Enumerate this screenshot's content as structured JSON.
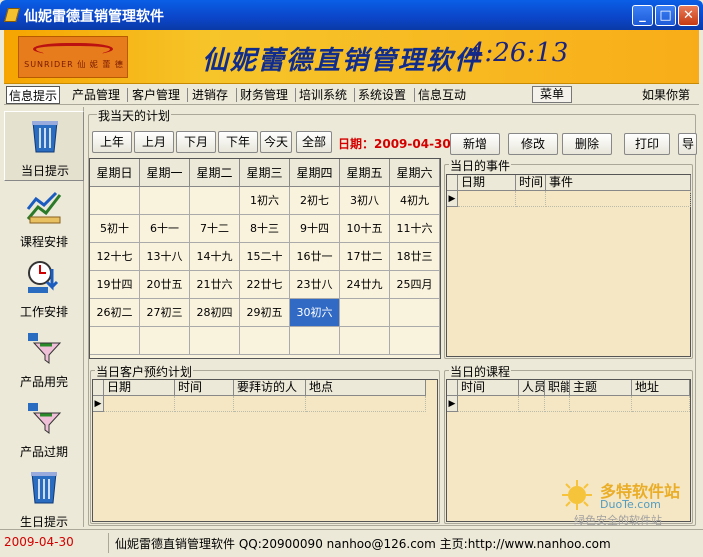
{
  "window": {
    "title": "仙妮雷德直销管理软件"
  },
  "banner": {
    "title": "仙妮蕾德直销管理软件",
    "clock": "4:26:13",
    "logo_text": "SUNRIDER 仙 妮 蕾 德"
  },
  "menu": {
    "items": [
      "信息提示",
      "产品管理",
      "客户管理",
      "进销存",
      "财务管理",
      "培训系统",
      "系统设置",
      "信息互动"
    ],
    "menu_button": "菜单",
    "marquee": "如果你第"
  },
  "nav": {
    "items": [
      "当日提示",
      "课程安排",
      "工作安排",
      "产品用完",
      "产品过期",
      "生日提示"
    ]
  },
  "plan": {
    "group_title": "我当天的计划",
    "buttons": [
      "上年",
      "上月",
      "下月",
      "下年",
      "今天",
      "全部"
    ],
    "date_label": "日期：2009-04-30",
    "actions": [
      "新增",
      "修改",
      "删除",
      "打印",
      "导"
    ]
  },
  "calendar": {
    "weekdays": [
      "星期日",
      "星期一",
      "星期二",
      "星期三",
      "星期四",
      "星期五",
      "星期六"
    ],
    "weeks": [
      [
        "",
        "",
        "",
        "1初六",
        "2初七",
        "3初八",
        "4初九"
      ],
      [
        "5初十",
        "6十一",
        "7十二",
        "8十三",
        "9十四",
        "10十五",
        "11十六"
      ],
      [
        "12十七",
        "13十八",
        "14十九",
        "15二十",
        "16廿一",
        "17廿二",
        "18廿三"
      ],
      [
        "19廿四",
        "20廿五",
        "21廿六",
        "22廿七",
        "23廿八",
        "24廿九",
        "25四月"
      ],
      [
        "26初二",
        "27初三",
        "28初四",
        "29初五",
        "30初六",
        "",
        ""
      ],
      [
        "",
        "",
        "",
        "",
        "",
        "",
        ""
      ]
    ],
    "today": "30初六"
  },
  "events": {
    "title": "当日的事件",
    "columns": [
      "日期",
      "时间",
      "事件"
    ]
  },
  "appointments": {
    "title": "当日客户预约计划",
    "columns": [
      "日期",
      "时间",
      "要拜访的人",
      "地点"
    ]
  },
  "courses": {
    "title": "当日的课程",
    "columns": [
      "时间",
      "人员",
      "职能",
      "主题",
      "地址"
    ]
  },
  "status": {
    "date": "2009-04-30",
    "info": "仙妮雷德直销管理软件 QQ:20900090 nanhoo@126.com 主页:http://www.nanhoo.com"
  },
  "watermark": {
    "brand": "多特软件站",
    "url": "DuoTe.com",
    "slogan": "绿色安全的软件站"
  },
  "colors": {
    "titlebar": "#0b45c8",
    "banner": "#f6b21e",
    "grid_bg": "#f5e6c4",
    "today": "#316ac5",
    "date_red": "#d40000"
  }
}
